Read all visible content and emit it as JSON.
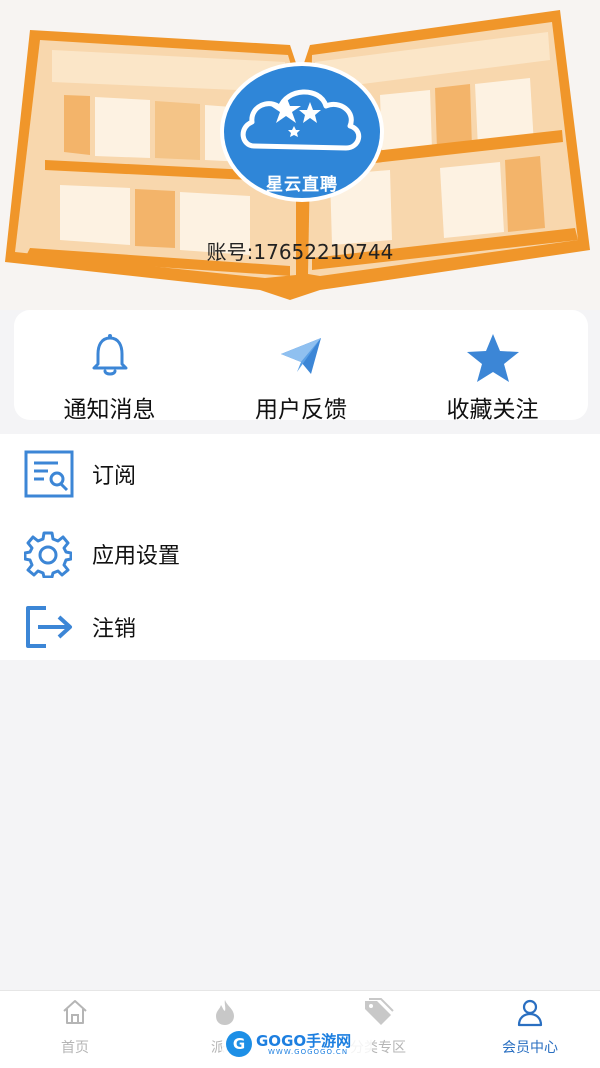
{
  "header": {
    "logo_text": "星云直聘",
    "account_text": "账号:17652210744"
  },
  "quick_actions": [
    {
      "label": "通知消息",
      "icon": "bell-icon"
    },
    {
      "label": "用户反馈",
      "icon": "paper-plane-icon"
    },
    {
      "label": "收藏关注",
      "icon": "star-icon"
    }
  ],
  "menu": [
    {
      "label": "订阅",
      "icon": "subscribe-document-icon"
    },
    {
      "label": "应用设置",
      "icon": "gear-icon"
    },
    {
      "label": "注销",
      "icon": "logout-icon"
    }
  ],
  "bottom_nav": [
    {
      "label": "首页",
      "icon": "home-icon",
      "active": false
    },
    {
      "label": "派单",
      "icon": "flame-icon",
      "active": false
    },
    {
      "label": "分类专区",
      "icon": "tag-icon",
      "active": false
    },
    {
      "label": "会员中心",
      "icon": "person-icon",
      "active": true
    }
  ],
  "watermark": {
    "text": "GOGO手游网",
    "url_text": "WWW.GOGOGO.CN"
  },
  "colors": {
    "accent_blue": "#2a7ed3",
    "icon_blue": "#3c86d6",
    "nav_active": "#2a6fc1",
    "nav_inactive": "#b5b5b5",
    "book_orange": "#f0962a"
  }
}
